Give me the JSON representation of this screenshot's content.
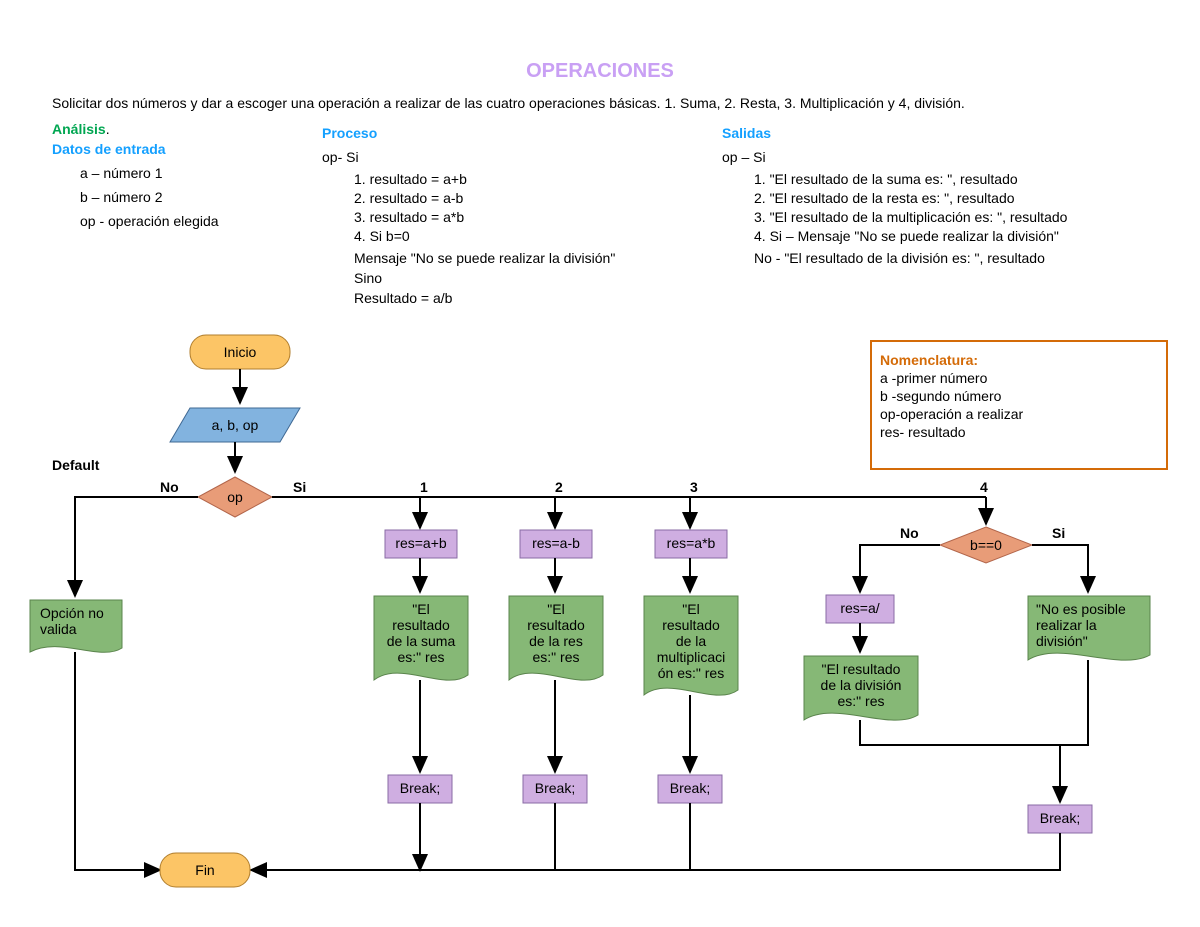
{
  "title": "OPERACIONES",
  "description": "Solicitar dos números y dar a escoger una operación a realizar de las cuatro operaciones básicas. 1. Suma, 2. Resta, 3. Multiplicación y 4, división.",
  "analysis": {
    "heading": "Análisis",
    "dot": "."
  },
  "inputs": {
    "heading": "Datos de entrada",
    "a": "a – número 1",
    "b": "b – número 2",
    "op": "op - operación elegida"
  },
  "process": {
    "heading": "Proceso",
    "opsi": "op- Si",
    "r1": "1.   resultado = a+b",
    "r2": "2.   resultado = a-b",
    "r3": "3.   resultado = a*b",
    "r4": "4.   Si b=0",
    "msg": "Mensaje \"No se puede realizar la división\"",
    "else": "Sino",
    "res": "Resultado = a/b"
  },
  "outputs": {
    "heading": "Salidas",
    "opsi": "op – Si",
    "o1": "1.   \"El resultado de la suma es: \", resultado",
    "o2": "2.   \"El resultado de la resta es: \", resultado",
    "o3": "3.   \"El resultado de la multiplicación  es: \", resultado",
    "o4": "4.   Si – Mensaje \"No se puede realizar la división\"",
    "ono": "No - \"El resultado de la división es: \", resultado"
  },
  "nomenclature": {
    "heading": "Nomenclatura:",
    "a": "a -primer número",
    "b": "b -segundo número",
    "op": "op-operación a realizar",
    "res": "res- resultado"
  },
  "flow": {
    "default": "Default",
    "start": "Inicio",
    "input": "a, b, op",
    "op": "op",
    "no": "No",
    "si": "Si",
    "c1": "1",
    "c2": "2",
    "c3": "3",
    "c4": "4",
    "r1": "res=a+b",
    "r2": "res=a-b",
    "r3": "res=a*b",
    "b0": "b==0",
    "r4": "res=a/",
    "m1a": "\"El",
    "m1b": "resultado",
    "m1c": "de la suma",
    "m1d": "es:\" res",
    "m2a": "\"El",
    "m2b": "resultado",
    "m2c": "de la res",
    "m2d": "es:\" res",
    "m3a": "\"El",
    "m3b": "resultado",
    "m3c": "de la",
    "m3d": "multiplicaci",
    "m3e": "ón es:\" res",
    "m4a": "\"El resultado",
    "m4b": "de la división",
    "m4c": "es:\" res",
    "m5a": "\"No es posible",
    "m5b": "realizar la",
    "m5c": "división\"",
    "inv1": "Opción no",
    "inv2": "valida",
    "break": "Break;",
    "end": "Fin"
  }
}
